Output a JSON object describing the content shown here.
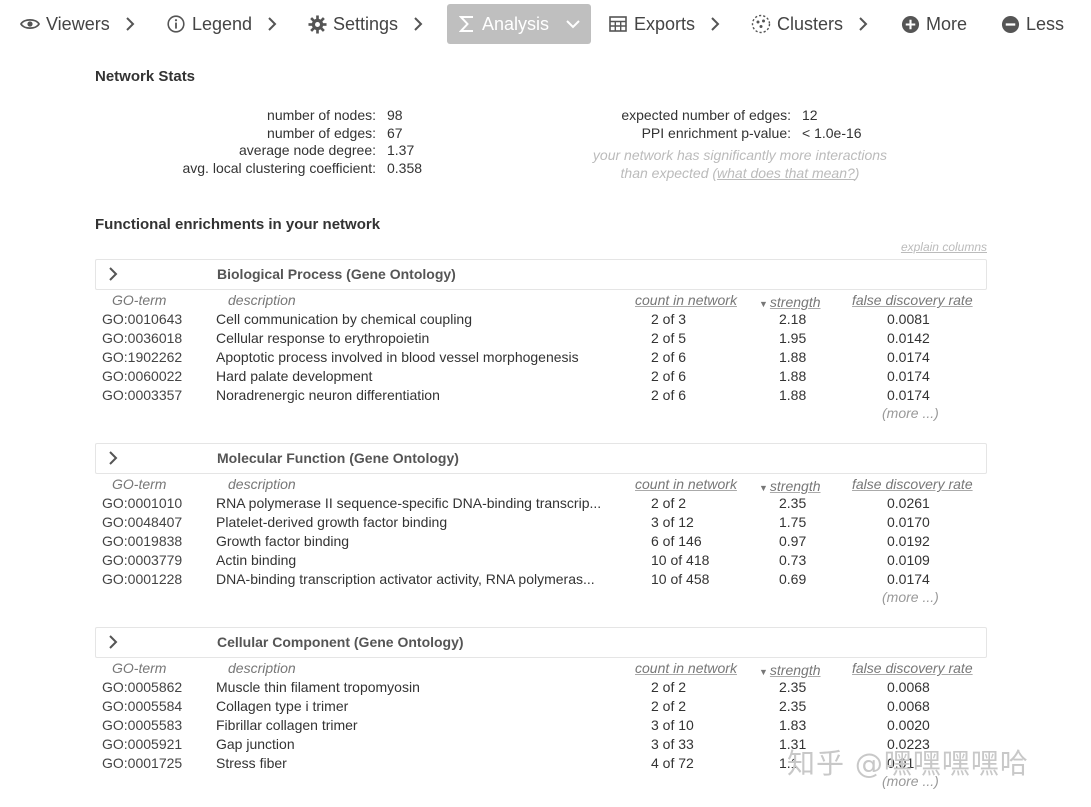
{
  "nav": {
    "viewers": "Viewers",
    "legend": "Legend",
    "settings": "Settings",
    "analysis": "Analysis",
    "exports": "Exports",
    "clusters": "Clusters",
    "more": "More",
    "less": "Less"
  },
  "network_stats": {
    "title": "Network Stats",
    "left": [
      {
        "label": "number of nodes:",
        "value": "98"
      },
      {
        "label": "number of edges:",
        "value": "67"
      },
      {
        "label": "average node degree:",
        "value": "1.37"
      },
      {
        "label": "avg. local clustering coefficient:",
        "value": "0.358"
      }
    ],
    "right": [
      {
        "label": "expected number of edges:",
        "value": "12"
      },
      {
        "label": "PPI enrichment p-value:",
        "value": "< 1.0e-16"
      }
    ],
    "note_line1": "your network has significantly more interactions",
    "note_line2": "than expected (",
    "note_link": "what does that mean?",
    "note_close": ")"
  },
  "enrichment": {
    "title": "Functional enrichments in your network",
    "explain_columns": "explain columns",
    "columns": {
      "term": "GO-term",
      "description": "description",
      "count": "count in network",
      "strength": "strength",
      "fdr": "false discovery rate"
    },
    "more_label": "(more ...)",
    "blocks": [
      {
        "title": "Biological Process (Gene Ontology)",
        "rows": [
          {
            "term": "GO:0010643",
            "description": "Cell communication by chemical coupling",
            "count": "2 of 3",
            "strength": "2.18",
            "fdr": "0.0081"
          },
          {
            "term": "GO:0036018",
            "description": "Cellular response to erythropoietin",
            "count": "2 of 5",
            "strength": "1.95",
            "fdr": "0.0142"
          },
          {
            "term": "GO:1902262",
            "description": "Apoptotic process involved in blood vessel morphogenesis",
            "count": "2 of 6",
            "strength": "1.88",
            "fdr": "0.0174"
          },
          {
            "term": "GO:0060022",
            "description": "Hard palate development",
            "count": "2 of 6",
            "strength": "1.88",
            "fdr": "0.0174"
          },
          {
            "term": "GO:0003357",
            "description": "Noradrenergic neuron differentiation",
            "count": "2 of 6",
            "strength": "1.88",
            "fdr": "0.0174"
          }
        ]
      },
      {
        "title": "Molecular Function (Gene Ontology)",
        "rows": [
          {
            "term": "GO:0001010",
            "description": "RNA polymerase II sequence-specific DNA-binding transcrip...",
            "count": "2 of 2",
            "strength": "2.35",
            "fdr": "0.0261"
          },
          {
            "term": "GO:0048407",
            "description": "Platelet-derived growth factor binding",
            "count": "3 of 12",
            "strength": "1.75",
            "fdr": "0.0170"
          },
          {
            "term": "GO:0019838",
            "description": "Growth factor binding",
            "count": "6 of 146",
            "strength": "0.97",
            "fdr": "0.0192"
          },
          {
            "term": "GO:0003779",
            "description": "Actin binding",
            "count": "10 of 418",
            "strength": "0.73",
            "fdr": "0.0109"
          },
          {
            "term": "GO:0001228",
            "description": "DNA-binding transcription activator activity, RNA polymeras...",
            "count": "10 of 458",
            "strength": "0.69",
            "fdr": "0.0174"
          }
        ]
      },
      {
        "title": "Cellular Component (Gene Ontology)",
        "rows": [
          {
            "term": "GO:0005862",
            "description": "Muscle thin filament tropomyosin",
            "count": "2 of 2",
            "strength": "2.35",
            "fdr": "0.0068"
          },
          {
            "term": "GO:0005584",
            "description": "Collagen type i trimer",
            "count": "2 of 2",
            "strength": "2.35",
            "fdr": "0.0068"
          },
          {
            "term": "GO:0005583",
            "description": "Fibrillar collagen trimer",
            "count": "3 of 10",
            "strength": "1.83",
            "fdr": "0.0020"
          },
          {
            "term": "GO:0005921",
            "description": "Gap junction",
            "count": "3 of 33",
            "strength": "1.31",
            "fdr": "0.0223"
          },
          {
            "term": "GO:0001725",
            "description": "Stress fiber",
            "count": "4 of 72",
            "strength": "1.1",
            "fdr": "0.01"
          }
        ]
      }
    ]
  },
  "watermark": "知乎 @嘿嘿嘿嘿哈"
}
